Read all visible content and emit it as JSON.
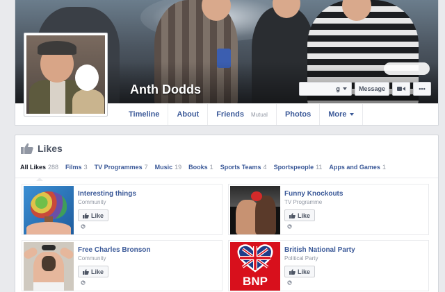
{
  "profile": {
    "name": "Anth Dodds"
  },
  "cover_actions": {
    "message_label": "Message",
    "more_label": "•••"
  },
  "timeline_nav": {
    "items": [
      {
        "label": "Timeline"
      },
      {
        "label": "About"
      },
      {
        "label": "Friends",
        "sub": "Mutual"
      },
      {
        "label": "Photos"
      },
      {
        "label": "More"
      }
    ]
  },
  "likes": {
    "title": "Likes",
    "tabs": [
      {
        "label": "All Likes",
        "count": "288"
      },
      {
        "label": "Films",
        "count": "3"
      },
      {
        "label": "TV Programmes",
        "count": "7"
      },
      {
        "label": "Music",
        "count": "19"
      },
      {
        "label": "Books",
        "count": "1"
      },
      {
        "label": "Sports Teams",
        "count": "4"
      },
      {
        "label": "Sportspeople",
        "count": "11"
      },
      {
        "label": "Apps and Games",
        "count": "1"
      }
    ],
    "like_button_label": "Like",
    "items": [
      {
        "name": "Interesting things",
        "category": "Community"
      },
      {
        "name": "Funny Knockouts",
        "category": "TV Programme"
      },
      {
        "name": "Free Charles Bronson",
        "category": "Community"
      },
      {
        "name": "British National Party",
        "category": "Political Party",
        "logo_text": "BNP"
      }
    ]
  },
  "colors": {
    "link_blue": "#3b5998",
    "page_bg": "#e9eaed",
    "bnp_red": "#d8101c"
  },
  "icons": {
    "likes_header": "thumbs-up-icon",
    "like_button": "thumbs-up-icon",
    "privacy": "globe-icon",
    "video_call": "camera-icon"
  }
}
